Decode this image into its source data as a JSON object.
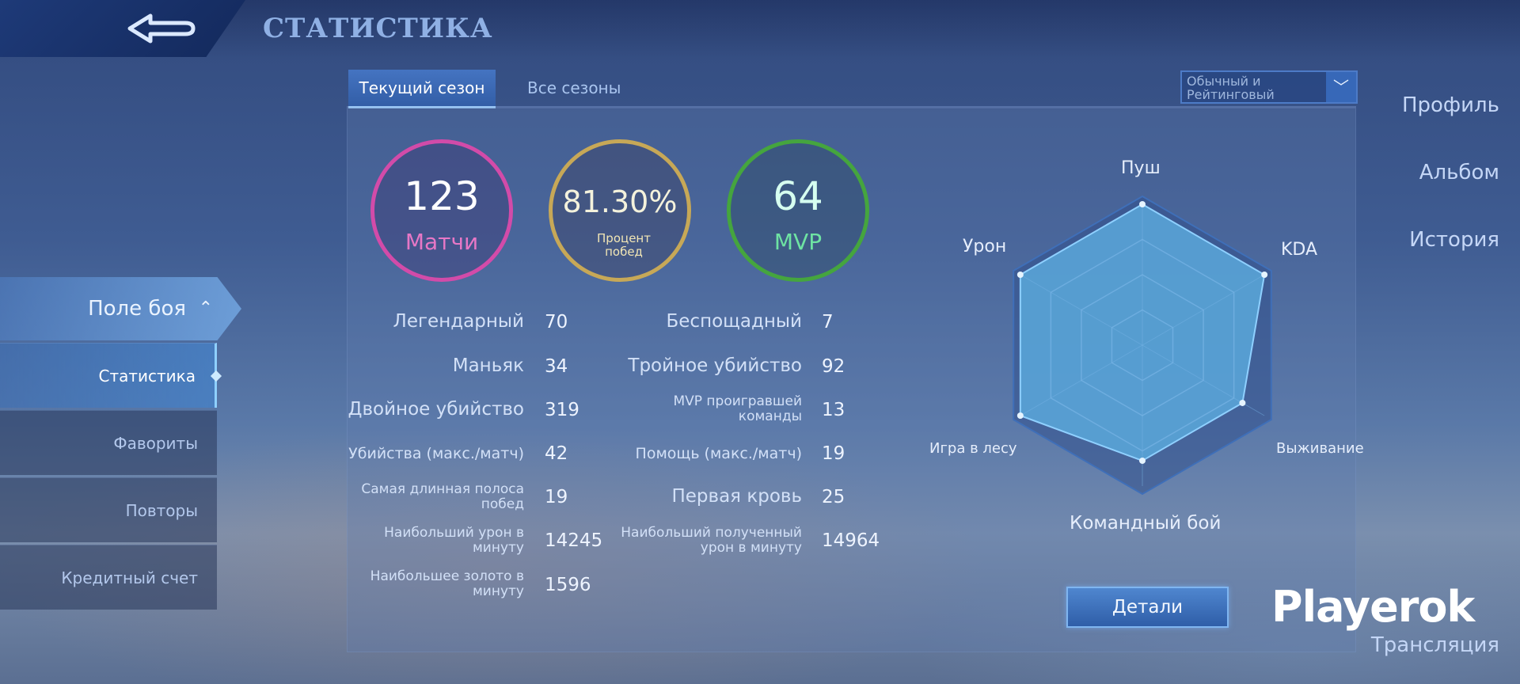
{
  "header": {
    "title": "СТАТИСТИКА"
  },
  "sidebar": {
    "items": [
      "Профиль",
      "Альбом",
      "История"
    ],
    "battle": "Поле боя",
    "subitems": [
      "Статистика",
      "Фавориты",
      "Повторы",
      "Кредитный счет"
    ],
    "last": "Трансляция"
  },
  "tabs": {
    "current": "Текущий сезон",
    "all": "Все сезоны"
  },
  "filter": {
    "value": "Обычный и Рейтинговый"
  },
  "summary": {
    "matches": {
      "value": "123",
      "label": "Матчи"
    },
    "winrate": {
      "value": "81.30%",
      "label": "Процент побед"
    },
    "mvp": {
      "value": "64",
      "label": "MVP"
    }
  },
  "stats": {
    "left": [
      {
        "label": "Легендарный",
        "value": "70"
      },
      {
        "label": "Маньяк",
        "value": "34"
      },
      {
        "label": "Двойное убийство",
        "value": "319"
      },
      {
        "label": "Убийства (макс./матч)",
        "value": "42"
      },
      {
        "label": "Самая длинная полоса побед",
        "value": "19"
      },
      {
        "label": "Наибольший урон в минуту",
        "value": "14245"
      },
      {
        "label": "Наибольшее золото в минуту",
        "value": "1596"
      }
    ],
    "right": [
      {
        "label": "Беспощадный",
        "value": "7"
      },
      {
        "label": "Тройное убийство",
        "value": "92"
      },
      {
        "label": "MVP проигравшей команды",
        "value": "13"
      },
      {
        "label": "Помощь (макс./матч)",
        "value": "19"
      },
      {
        "label": "Первая кровь",
        "value": "25"
      },
      {
        "label": "Наибольший полученный урон в минуту",
        "value": "14964"
      }
    ]
  },
  "radar": {
    "axes": [
      "Пуш",
      "KDA",
      "Выживание",
      "Командный бой",
      "Игра в лесу",
      "Урон"
    ],
    "values": [
      1.0,
      1.0,
      0.82,
      0.82,
      1.0,
      1.0
    ],
    "fill": "#5aa8da"
  },
  "buttons": {
    "details": "Детали"
  },
  "watermark": "Playerok"
}
